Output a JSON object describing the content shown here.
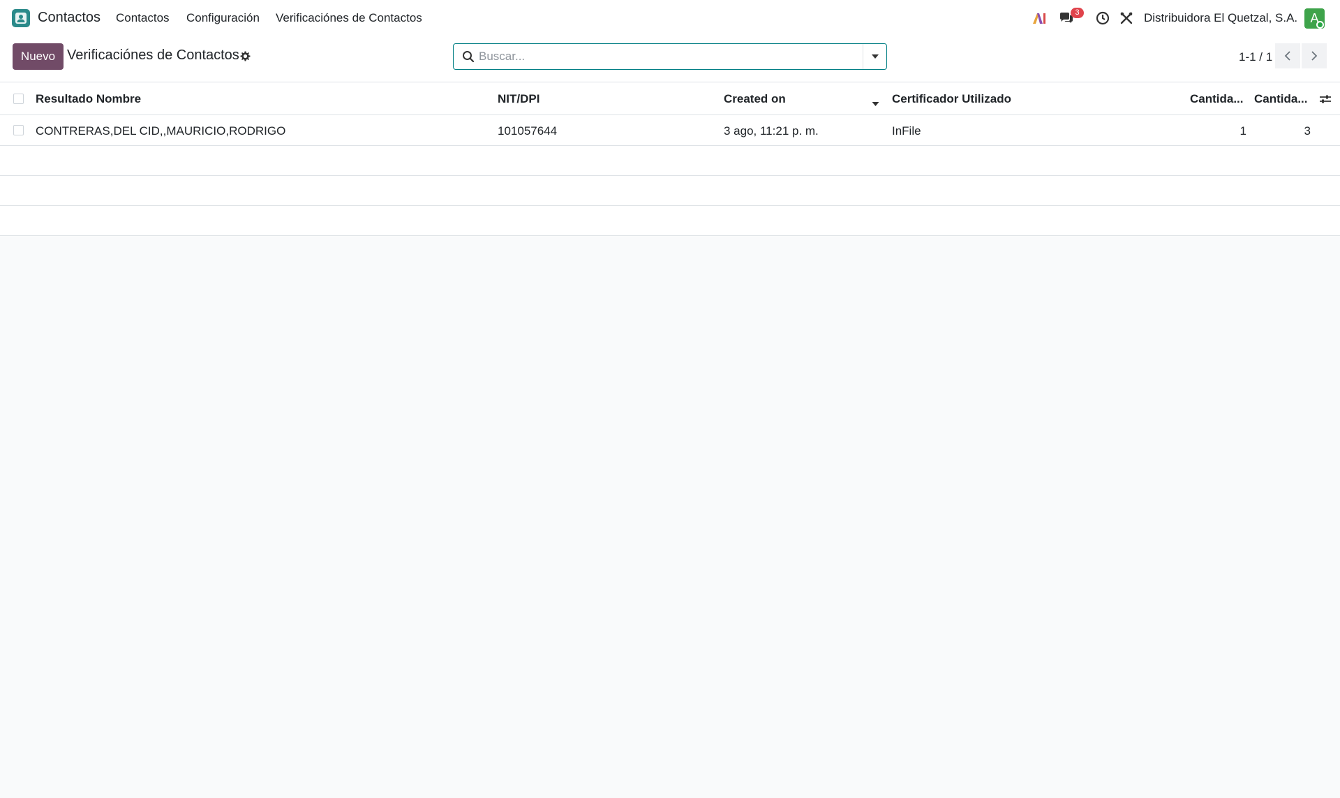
{
  "navbar": {
    "app_name": "Contactos",
    "menu": [
      "Contactos",
      "Configuración",
      "Verificaciónes de Contactos"
    ],
    "messages_count": "3",
    "company": "Distribuidora El Quetzal, S.A.",
    "avatar_letter": "A"
  },
  "control": {
    "new_label": "Nuevo",
    "title": "Verificaciónes de Contactos",
    "search_placeholder": "Buscar...",
    "pager": "1-1 / 1"
  },
  "table": {
    "columns": [
      "Resultado Nombre",
      "NIT/DPI",
      "Created on",
      "Certificador Utilizado",
      "Cantida...",
      "Cantida..."
    ],
    "rows": [
      [
        "CONTRERAS,DEL CID,,MAURICIO,RODRIGO",
        "101057644",
        "3 ago, 11:21 p. m.",
        "InFile",
        "1",
        "3"
      ]
    ]
  },
  "colors": {
    "brand": "#714b67",
    "search_border": "#017e84",
    "badge": "#e0434b",
    "avatar": "#3ea34a"
  },
  "icons": [
    "contacts-app-icon",
    "ai-icon",
    "chat-icon",
    "clock-icon",
    "tools-icon",
    "gear-icon",
    "search-icon",
    "caret-down-icon",
    "chevron-left-icon",
    "chevron-right-icon",
    "sort-desc-icon",
    "column-settings-icon"
  ]
}
